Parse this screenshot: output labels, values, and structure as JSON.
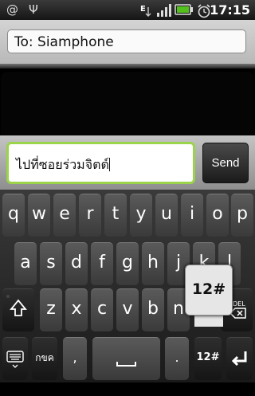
{
  "status_bar": {
    "notifications": [
      "@",
      "Ψ"
    ],
    "network_label": "E",
    "time": "17:15"
  },
  "recipient": {
    "value": "To: Siamphone"
  },
  "compose": {
    "message_text": "ไปที่ซอยร่วมจิตต์",
    "send_label": "Send"
  },
  "keyboard": {
    "row1": [
      "q",
      "w",
      "e",
      "r",
      "t",
      "y",
      "u",
      "i",
      "o",
      "p"
    ],
    "row2": [
      "a",
      "s",
      "d",
      "f",
      "g",
      "h",
      "j",
      "k",
      "l"
    ],
    "row3": [
      "z",
      "x",
      "c",
      "v",
      "b",
      "n"
    ],
    "mode_label": "กขค",
    "symbols_label": "12#",
    "comma": ",",
    "period": ".",
    "del_label": "DEL",
    "popup_label": "12#"
  }
}
